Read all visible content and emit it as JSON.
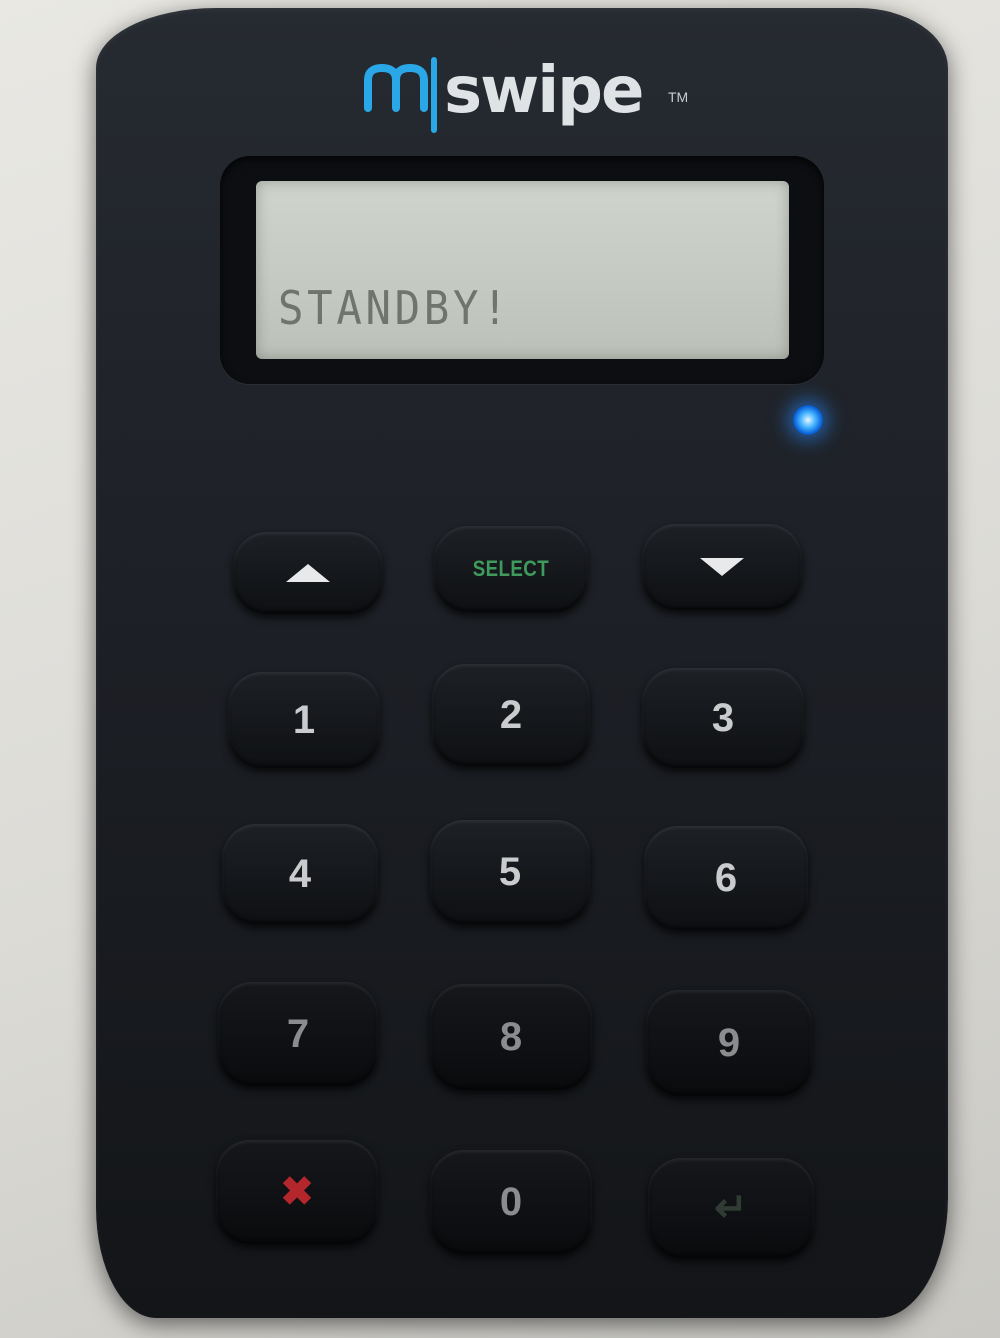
{
  "device": {
    "brand": "mswipe",
    "trademark": "TM",
    "display_text": "STANDBY!",
    "led_color": "#2f95ff",
    "brand_color": "#2aa7e6"
  },
  "keys": {
    "up": "up-arrow",
    "select": "SELECT",
    "down": "down-arrow",
    "k1": "1",
    "k2": "2",
    "k3": "3",
    "k4": "4",
    "k5": "5",
    "k6": "6",
    "k7": "7",
    "k8": "8",
    "k9": "9",
    "cancel": "✖",
    "k0": "0",
    "enter": "↵"
  }
}
